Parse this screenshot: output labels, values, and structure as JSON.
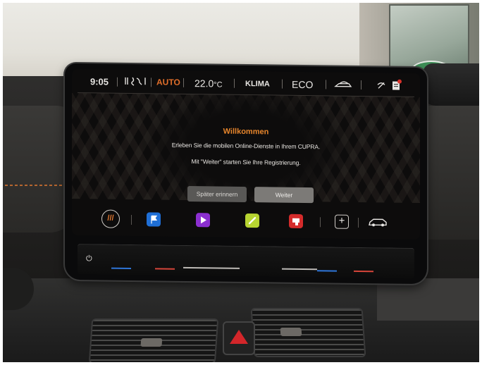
{
  "status_bar": {
    "time": "9:05",
    "auto_label": "AUTO",
    "temperature": "22.0",
    "temperature_unit": "°C",
    "klima_label": "KLIMA",
    "eco_label": "ECO"
  },
  "welcome": {
    "title": "Willkommen",
    "line1": "Erleben Sie die mobilen Online-Dienste in Ihrem CUPRA.",
    "line2": "Mit \"Weiter\" starten Sie Ihre Registrierung."
  },
  "buttons": {
    "later_label": "Später erinnern",
    "next_label": "Weiter"
  },
  "dock": {
    "icons": [
      {
        "name": "menu-icon",
        "color": "#e57b33"
      },
      {
        "name": "navigation-flag-icon",
        "color": "#1f6fd6"
      },
      {
        "name": "media-play-icon",
        "color": "#8b2fd0"
      },
      {
        "name": "phone-icon",
        "color": "#b7d431"
      },
      {
        "name": "app-connect-icon",
        "color": "#d42b2b"
      },
      {
        "name": "add-icon",
        "color": "#e8e6e3"
      },
      {
        "name": "car-icon",
        "color": "#e8e6e3"
      }
    ]
  },
  "colors": {
    "accent_orange": "#e8862c",
    "screen_background": "#0d0c0c"
  }
}
